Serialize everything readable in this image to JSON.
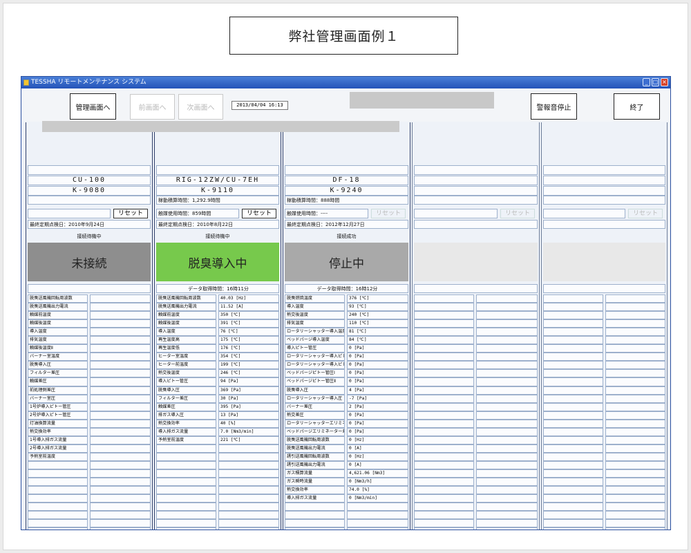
{
  "caption": "弊社管理画面例１",
  "window": {
    "title": "TESSHA リモートメンテナンス システム"
  },
  "toolbar": {
    "manage_label": "管理画面へ",
    "prev_label": "前画面へ",
    "next_label": "次画面へ",
    "datetime": "2013/04/04 16:13",
    "alarm_stop_label": "警報音停止",
    "exit_label": "終了"
  },
  "reset_label": "リセット",
  "units": [
    {
      "model1": "CU-100",
      "model2": "K-9080",
      "line1": "",
      "line2": "",
      "last_check": "最終定期点検日：2010年9月24日",
      "connection": "接続待機中",
      "status": "未接続",
      "status_color": "#8e8e8e",
      "data_time": "",
      "labels": [
        "脱臭送風機回転周波数",
        "脱臭送風機出力電流",
        "触媒前温度",
        "触媒後温度",
        "導入温度",
        "排気温度",
        "触媒後温度Ⅱ",
        "バーナー室温度",
        "脱臭導入圧",
        "フィルター差圧",
        "触媒差圧",
        "前処理側差圧",
        "バーナー室圧",
        "1号炉導入ピトー管圧",
        "2号炉導入ピトー管圧",
        "灯油換算流量",
        "熱交換効率",
        "1号導入排ガス流量",
        "2号導入排ガス流量",
        "予熱室前温度"
      ],
      "values": []
    },
    {
      "model1": "RIG-12ZW/CU-7EH",
      "model2": "K-9110",
      "line1": "稼動積算時間：1,292.9時間",
      "line2": "触媒使用時間：859時間",
      "last_check": "最終定期点検日：2010年8月22日",
      "connection": "接続待機中",
      "status": "脱臭導入中",
      "status_color": "#77c94c",
      "data_time": "データ取得時間：16時11分",
      "labels": [
        "脱臭送風機回転周波数",
        "脱臭送風機出力電流",
        "触媒前温度",
        "触媒後温度",
        "導入温度",
        "再生温度高",
        "再生温度低",
        "ヒーター室温度",
        "ヒーター前温度",
        "熱交後温度",
        "導入ピトー管圧",
        "脱臭導入圧",
        "フィルター差圧",
        "触媒差圧",
        "排ガス導入圧",
        "熱交換効率",
        "導入排ガス流量",
        "予熱室前温度"
      ],
      "values": [
        "40.03 [Hz]",
        "11.52 [A]",
        "350 [℃]",
        "391 [℃]",
        "76 [℃]",
        "175 [℃]",
        "176 [℃]",
        "354 [℃]",
        "199 [℃]",
        "246 [℃]",
        "94 [Pa]",
        "369 [Pa]",
        "30 [Pa]",
        "395 [Pa]",
        "13 [Pa]",
        "40 [%]",
        "7.0 [Nm3/min]",
        "221 [℃]"
      ]
    },
    {
      "model1": "DF-18",
      "model2": "K-9240",
      "line1": "稼動積算時間：888時間",
      "line2": "触媒使用時間：----",
      "last_check": "最終定期点検日：2012年12月27日",
      "connection": "接続成功",
      "status": "停止中",
      "status_color": "#a9a9a9",
      "data_time": "データ取得時間：16時12分",
      "labels": [
        "脱臭燃焼温度",
        "導入温度",
        "熱交後温度",
        "排気温度",
        "ロータリーシャッター導入温度",
        "ベッドパージ導入温度",
        "導入ピトー管圧",
        "ロータリーシャッター導入ピトー管圧Ⅰ",
        "ロータリーシャッター導入ピトー管圧Ⅱ",
        "ベッドパージピトー管圧Ⅰ",
        "ベッドパージピトー管圧Ⅱ",
        "脱臭導入圧",
        "ロータリーシャッター導入圧",
        "バーナー差圧",
        "熱交差圧",
        "ロータリーシャッターエリミネーター差圧",
        "ベッドパージエリミネーター差圧",
        "脱臭送風機回転周波数",
        "脱臭送風機出力電流",
        "誘引送風機回転周波数",
        "誘引送風機出力電流",
        "ガス積算流量",
        "ガス瞬時流量",
        "熱交換効率",
        "導入排ガス流量"
      ],
      "values": [
        "376 [℃]",
        "93 [℃]",
        "240 [℃]",
        "110 [℃]",
        "81 [℃]",
        "84 [℃]",
        "0 [Pa]",
        "0 [Pa]",
        "0 [Pa]",
        "0 [Pa]",
        "0 [Pa]",
        "4 [Pa]",
        "-7 [Pa]",
        "2 [Pa]",
        "0 [Pa]",
        "0 [Pa]",
        "0 [Pa]",
        "0 [Hz]",
        "0 [A]",
        "0 [Hz]",
        "0 [A]",
        "4,621.06 [Nm3]",
        "0 [Nm3/h]",
        "74.0 [%]",
        "0 [Nm3/min]"
      ]
    },
    {
      "model1": "",
      "model2": "",
      "line1": "",
      "line2": "",
      "last_check": "",
      "connection": "",
      "status": "",
      "status_color": "#e8e8e8",
      "data_time": "",
      "labels": [],
      "values": []
    },
    {
      "model1": "",
      "model2": "",
      "line1": "",
      "line2": "",
      "last_check": "",
      "connection": "",
      "status": "",
      "status_color": "#e8e8e8",
      "data_time": "",
      "labels": [],
      "values": []
    }
  ]
}
